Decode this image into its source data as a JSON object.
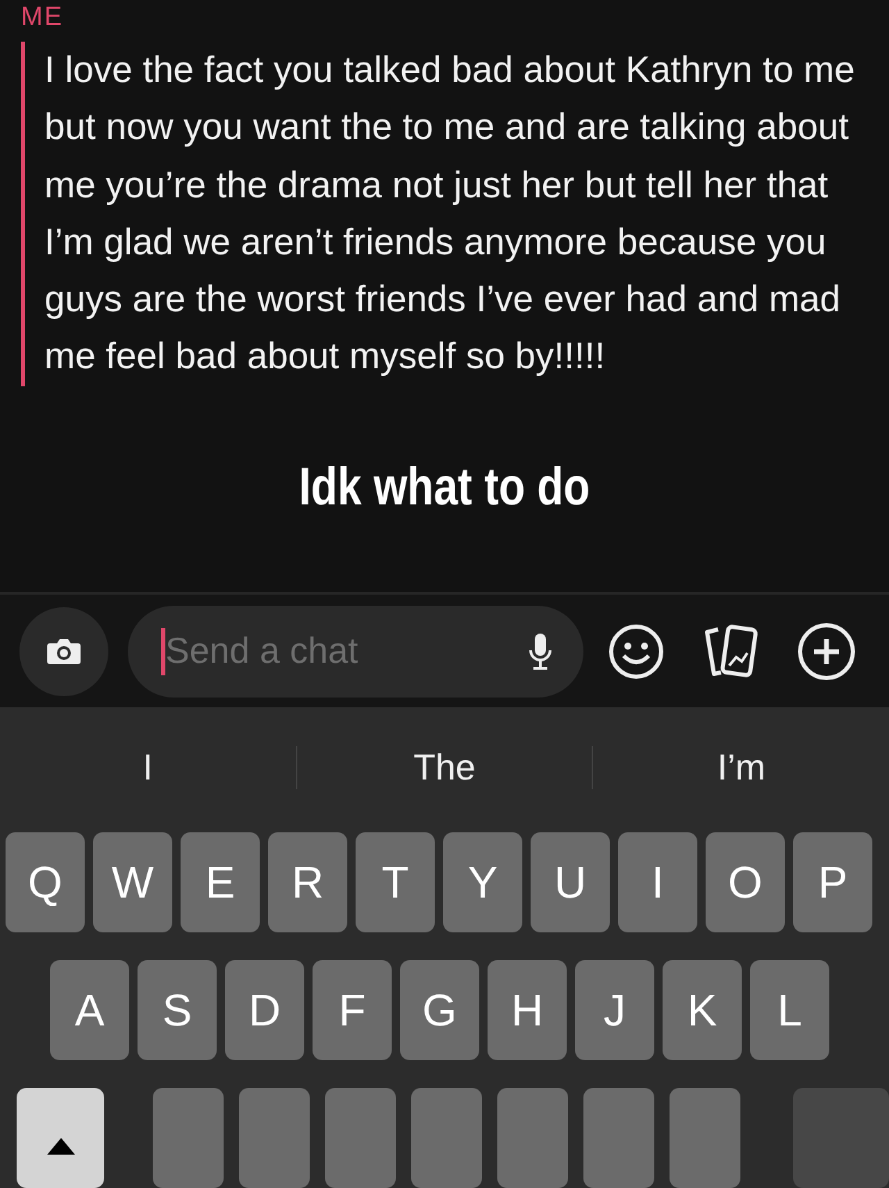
{
  "message": {
    "sender": "ME",
    "text": "I love the fact you talked bad about Kathryn to me but now you want the to me and are talking about me you’re the drama not just her but tell her that I’m glad we aren’t friends anymore because you guys are the worst friends I’ve ever had and mad me feel bad about myself so by!!!!!"
  },
  "caption": "Idk what to do",
  "chat_bar": {
    "placeholder": "Send a chat"
  },
  "suggestions": [
    "I",
    "The",
    "I’m"
  ],
  "keyboard": {
    "rows": [
      [
        "Q",
        "W",
        "E",
        "R",
        "T",
        "Y",
        "U",
        "I",
        "O",
        "P"
      ],
      [
        "A",
        "S",
        "D",
        "F",
        "G",
        "H",
        "J",
        "K",
        "L"
      ]
    ]
  }
}
